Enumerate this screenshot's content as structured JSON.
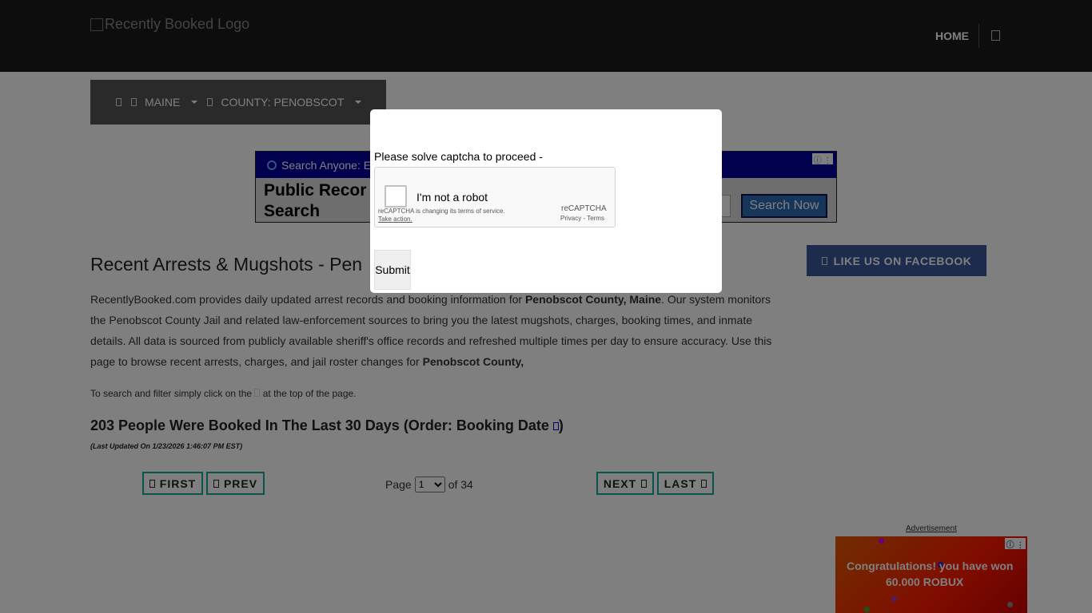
{
  "header": {
    "logo_alt": "Recently Booked Logo",
    "nav_home": "HOME",
    "search_icon": "search-icon"
  },
  "breadcrumb": {
    "home_icon": "home-icon",
    "state_icon": "map-marker-icon",
    "state_label": "MAINE",
    "county_icon": "map-marker-icon",
    "county_label": "COUNTY: PENOBSCOT"
  },
  "ad_top": {
    "bar_text": "Search Anyone: E",
    "headline": "Public Recor Search",
    "button": "Search Now"
  },
  "main": {
    "title": "Recent Arrests & Mugshots - Pen",
    "desc_1": "RecentlyBooked.com provides daily updated arrest records and booking information for ",
    "desc_bold_1": "Penobscot County, Maine",
    "desc_2": ". Our system monitors the Penobscot County Jail and related law-enforcement sources to bring you the latest mugshots, charges, booking times, and inmate details. All data is sourced from publicly available sheriff's office records and refreshed multiple times per day to ensure accuracy. Use this page to browse recent arrests, charges, and jail roster changes for ",
    "desc_bold_2": "Penobscot County,",
    "hint_a": "To search and filter simply click on the ",
    "hint_b": " at the top of the page.",
    "booked_title": "203 People Were Booked In The Last 30 Days (Order: Booking Date ",
    "booked_close": ")",
    "updated": "(Last Updated On 1/23/2026 1:46:07 PM EST)"
  },
  "facebook": {
    "label": "LIKE US ON FACEBOOK",
    "icon": "facebook-icon"
  },
  "pagination": {
    "first": "FIRST",
    "prev": "PREV",
    "next": "NEXT",
    "last": "LAST",
    "page_label": "Page",
    "current_page": "1",
    "of_label": "of 34"
  },
  "ad_right": {
    "label": "Advertisement",
    "line1": "Congratulations! you have won",
    "line2": "60.000 ROBUX"
  },
  "modal": {
    "prompt": "Please solve captcha to proceed -",
    "captcha_label": "I'm not a robot",
    "captcha_brand": "reCAPTCHA",
    "captcha_links": "Privacy - Terms",
    "captcha_notice": "reCAPTCHA is changing its terms of service.",
    "captcha_action": "Take action.",
    "submit": "Submit"
  },
  "colors": {
    "topbar": "#1b1b1b",
    "breadcrumb": "#555555",
    "facebook": "#3b5998",
    "pager_border": "#13a89e",
    "overlay": "rgba(0,0,0,0.5)"
  }
}
